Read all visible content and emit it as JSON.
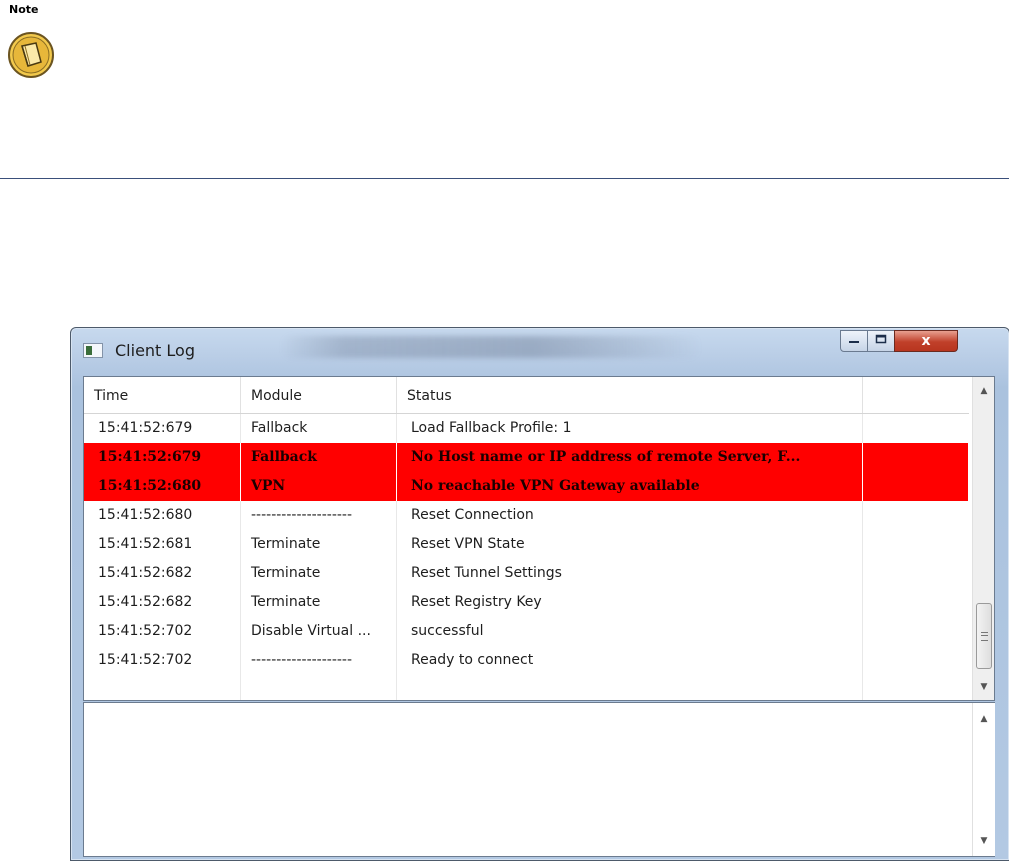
{
  "note": {
    "label": "Note",
    "icon": "note-pad-icon"
  },
  "window": {
    "title": "Client Log",
    "controls": {
      "minimize_icon": "minimize-icon",
      "maximize_icon": "maximize-icon",
      "close_icon": "close-icon",
      "close_glyph": "x"
    }
  },
  "log": {
    "columns": [
      "Time",
      "Module",
      "Status",
      ""
    ],
    "rows": [
      {
        "time": "15:41:52:679",
        "module": "Fallback",
        "status": "Load Fallback Profile: 1",
        "error": false
      },
      {
        "time": "15:41:52:679",
        "module": "Fallback",
        "status": "No Host name or IP address of remote Server,  F...",
        "error": true
      },
      {
        "time": "15:41:52:680",
        "module": "VPN",
        "status": "No reachable VPN Gateway available",
        "error": true
      },
      {
        "time": "15:41:52:680",
        "module": "--------------------",
        "status": "Reset Connection",
        "error": false
      },
      {
        "time": "15:41:52:681",
        "module": "Terminate",
        "status": "Reset VPN State",
        "error": false
      },
      {
        "time": "15:41:52:682",
        "module": "Terminate",
        "status": "Reset Tunnel Settings",
        "error": false
      },
      {
        "time": "15:41:52:682",
        "module": "Terminate",
        "status": "Reset Registry Key",
        "error": false
      },
      {
        "time": "15:41:52:702",
        "module": "Disable Virtual ...",
        "status": "successful",
        "error": false
      },
      {
        "time": "15:41:52:702",
        "module": "--------------------",
        "status": "Ready to connect",
        "error": false
      },
      {
        "time": "",
        "module": "",
        "status": "",
        "error": false
      }
    ]
  },
  "colors": {
    "error_row": "#ff0000",
    "rule": "#3a4f7a",
    "titlebar": "#b9cde6"
  }
}
